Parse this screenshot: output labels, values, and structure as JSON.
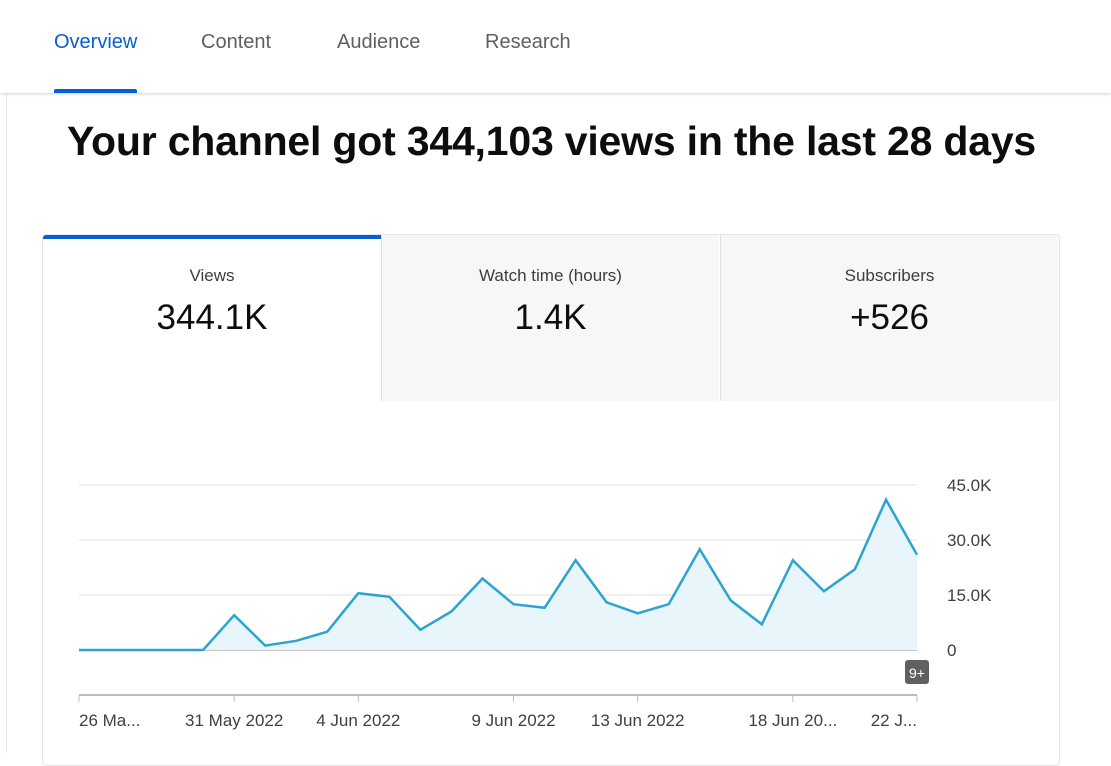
{
  "tabs": [
    {
      "label": "Overview",
      "active": true
    },
    {
      "label": "Content",
      "active": false
    },
    {
      "label": "Audience",
      "active": false
    },
    {
      "label": "Research",
      "active": false
    }
  ],
  "headline": "Your channel got 344,103 views in the last 28 days",
  "metrics": [
    {
      "label": "Views",
      "value": "344.1K",
      "active": true
    },
    {
      "label": "Watch time (hours)",
      "value": "1.4K",
      "active": false
    },
    {
      "label": "Subscribers",
      "value": "+526",
      "active": false
    }
  ],
  "colors": {
    "accent": "#065fd4",
    "line": "#2fa3cf",
    "area": "#e8f5fb"
  },
  "badge": "9+",
  "chart_data": {
    "type": "area",
    "x_tick_labels": [
      "26 Ma...",
      "31 May 2022",
      "4 Jun 2022",
      "9 Jun 2022",
      "13 Jun 2022",
      "18 Jun 20...",
      "22 J..."
    ],
    "y_tick_labels": [
      "45.0K",
      "30.0K",
      "15.0K",
      "0"
    ],
    "ylim": [
      0,
      45000
    ],
    "grid": true,
    "series": [
      {
        "values": [
          0,
          0,
          0,
          0,
          0,
          9500,
          1200,
          2500,
          5000,
          15500,
          14500,
          5500,
          10500,
          19500,
          12500,
          11500,
          24500,
          13000,
          10000,
          12500,
          27500,
          13500,
          7000,
          24500,
          16000,
          22000,
          41000,
          26000
        ]
      }
    ]
  }
}
